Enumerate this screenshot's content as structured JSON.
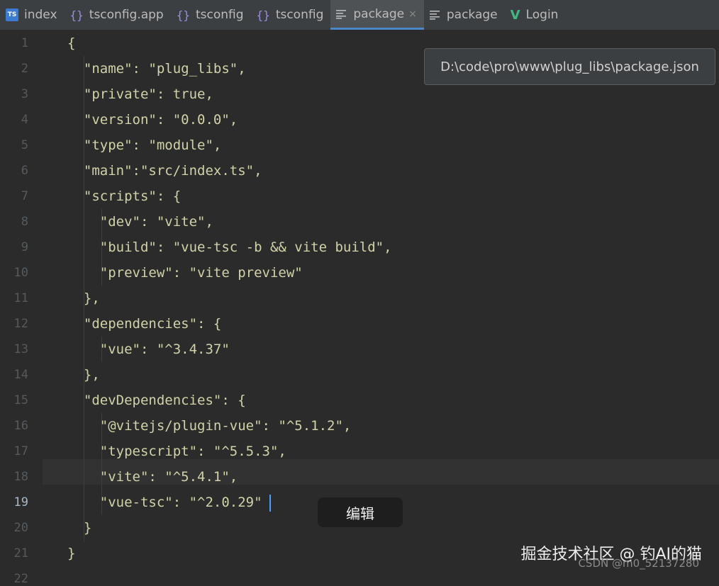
{
  "tabs": [
    {
      "label": "index",
      "icon": "ts-file-icon",
      "active": false
    },
    {
      "label": "tsconfig.app",
      "icon": "json-braces-icon",
      "active": false
    },
    {
      "label": "tsconfig",
      "icon": "json-braces-icon",
      "active": false
    },
    {
      "label": "tsconfig",
      "icon": "json-braces-icon",
      "active": false
    },
    {
      "label": "package",
      "icon": "text-lines-icon",
      "active": true,
      "close": "×"
    },
    {
      "label": "package",
      "icon": "text-lines-icon",
      "active": false
    },
    {
      "label": "Login",
      "icon": "vue-file-icon",
      "active": false
    }
  ],
  "tooltip": {
    "path": "D:\\code\\pro\\www\\plug_libs\\package.json"
  },
  "editor": {
    "current_line": "19",
    "line_numbers": [
      "1",
      "2",
      "3",
      "4",
      "5",
      "6",
      "7",
      "8",
      "9",
      "10",
      "11",
      "12",
      "13",
      "14",
      "15",
      "16",
      "17",
      "18",
      "19",
      "20",
      "21",
      "22"
    ],
    "lines": [
      "{",
      "  \"name\": \"plug_libs\",",
      "  \"private\": true,",
      "  \"version\": \"0.0.0\",",
      "  \"type\": \"module\",",
      "  \"main\":\"src/index.ts\",",
      "  \"scripts\": {",
      "    \"dev\": \"vite\",",
      "    \"build\": \"vue-tsc -b && vite build\",",
      "    \"preview\": \"vite preview\"",
      "  },",
      "  \"dependencies\": {",
      "    \"vue\": \"^3.4.37\"",
      "  },",
      "  \"devDependencies\": {",
      "    \"@vitejs/plugin-vue\": \"^5.1.2\",",
      "    \"typescript\": \"^5.5.3\",",
      "    \"vite\": \"^5.4.1\",",
      "    \"vue-tsc\": \"^2.0.29\"",
      "  }",
      "}"
    ]
  },
  "edit_badge": "编辑",
  "watermark": {
    "line1": "掘金技术社区 @ 钓AI的猫",
    "line2": "CSDN @m0_52137280"
  },
  "colors": {
    "background": "#2b2b2b",
    "tab_bar": "#3c3f41",
    "code_text": "#d2d2a8",
    "active_tab_underline": "#4a88c7"
  }
}
